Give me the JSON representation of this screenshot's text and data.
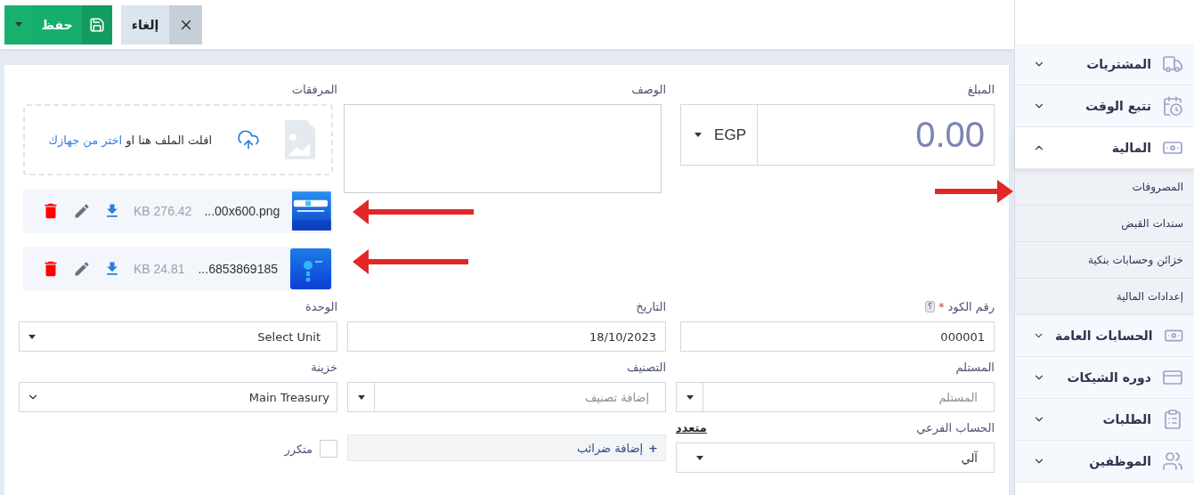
{
  "toolbar": {
    "save": {
      "label": "حفظ"
    },
    "cancel": {
      "label": "إلغاء"
    }
  },
  "form": {
    "amount": {
      "label": "المبلغ",
      "value": "0.00",
      "currency": "EGP"
    },
    "description": {
      "label": "الوصف"
    },
    "attachments": {
      "label": "المرفقات",
      "drop_text": "افلت الملف هنا او",
      "drop_link": "اختر من جهازك",
      "files": [
        {
          "name": "...00x600.png",
          "size": "KB 276.42"
        },
        {
          "name": "...6853869185",
          "size": "KB 24.81"
        }
      ]
    },
    "code": {
      "label": "رقم الكود",
      "required_mark": "*",
      "help": "؟",
      "value": "000001"
    },
    "date": {
      "label": "التاريخ",
      "value": "18/10/2023"
    },
    "unit": {
      "label": "الوحدة",
      "value": "Select Unit"
    },
    "recipient": {
      "label": "المستلم",
      "placeholder": "المستلم"
    },
    "category": {
      "label": "التصنيف",
      "placeholder": "إضافة تصنيف"
    },
    "treasury": {
      "label": "خزينة",
      "value": "Main Treasury"
    },
    "subaccount": {
      "label": "الحساب الفرعي",
      "link": "متعدد",
      "value": "آلي"
    },
    "taxes": {
      "label": "إضافة ضرائب",
      "icon": "+"
    },
    "recurring": {
      "label": "متكرر",
      "checked": false
    }
  },
  "sidebar": {
    "items": [
      {
        "label": "المشتريات",
        "expanded": false
      },
      {
        "label": "تتبع الوقت",
        "expanded": false
      },
      {
        "label": "المالية",
        "expanded": true,
        "children": [
          {
            "label": "المصروفات"
          },
          {
            "label": "سندات القبض"
          },
          {
            "label": "خزائن وحسابات بنكية"
          },
          {
            "label": "إعدادات المالية"
          }
        ]
      },
      {
        "label": "الحسابات العامة",
        "expanded": false
      },
      {
        "label": "دوره الشيكات",
        "expanded": false
      },
      {
        "label": "الطلبات",
        "expanded": false
      },
      {
        "label": "الموظفين",
        "expanded": false
      }
    ]
  }
}
